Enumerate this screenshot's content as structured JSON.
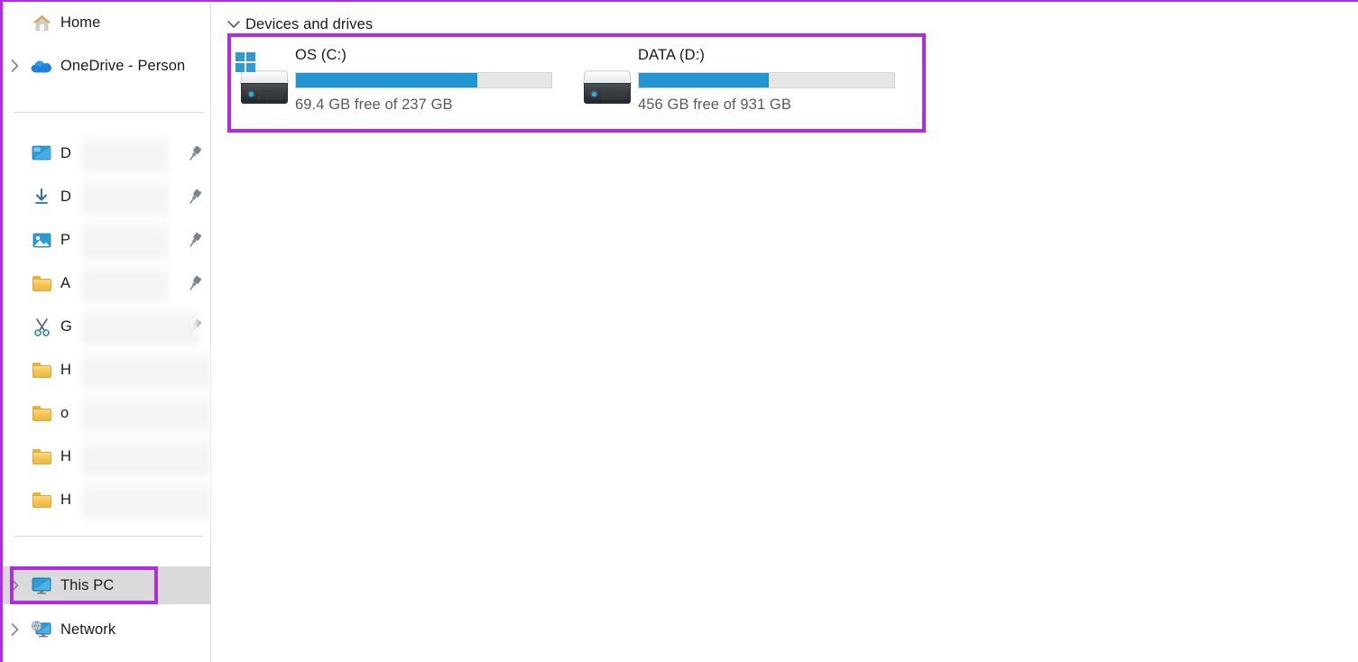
{
  "window": {
    "accent_purple": "#b02ae8",
    "selection_gray": "#dadada",
    "bar_blue": "#2196d3",
    "bar_track": "#e6e6e6"
  },
  "sidebar": {
    "items": [
      {
        "label": "Home",
        "icon": "home-icon",
        "chevron": false,
        "pinned": false,
        "blurred": false
      },
      {
        "label": "OneDrive - Person",
        "icon": "onedrive-cloud-icon",
        "chevron": true,
        "pinned": false,
        "blurred": false
      },
      {
        "label": "D",
        "icon": "desktop-icon",
        "chevron": false,
        "pinned": true,
        "blurred": true
      },
      {
        "label": "D",
        "icon": "downloads-icon",
        "chevron": false,
        "pinned": true,
        "blurred": true
      },
      {
        "label": "P",
        "icon": "pictures-icon",
        "chevron": false,
        "pinned": true,
        "blurred": true
      },
      {
        "label": "A",
        "icon": "folder-icon",
        "chevron": false,
        "pinned": true,
        "blurred": true
      },
      {
        "label": "G",
        "icon": "scissors-icon",
        "chevron": false,
        "pinned": true,
        "blurred": true
      },
      {
        "label": "H",
        "icon": "folder-icon",
        "chevron": false,
        "pinned": false,
        "blurred": true
      },
      {
        "label": "o",
        "icon": "folder-icon",
        "chevron": false,
        "pinned": false,
        "blurred": true
      },
      {
        "label": "H",
        "icon": "folder-icon",
        "chevron": false,
        "pinned": false,
        "blurred": true
      },
      {
        "label": "H",
        "icon": "folder-icon",
        "chevron": false,
        "pinned": false,
        "blurred": true
      },
      {
        "label": "This PC",
        "icon": "this-pc-icon",
        "chevron": true,
        "pinned": false,
        "blurred": false,
        "selected": true,
        "highlighted": true
      },
      {
        "label": "Network",
        "icon": "network-icon",
        "chevron": true,
        "pinned": false,
        "blurred": false
      }
    ]
  },
  "main": {
    "group": {
      "title": "Devices and drives",
      "expanded": true,
      "chevron_icon": "chevron-down-icon",
      "highlighted": true
    },
    "drives": [
      {
        "name": "OS (C:)",
        "free_text": "69.4 GB free of 237 GB",
        "free_value": "69.4 GB",
        "total_value": "237 GB",
        "used_percent": 71,
        "icon": "windows-drive-icon"
      },
      {
        "name": "DATA (D:)",
        "free_text": "456 GB free of 931 GB",
        "free_value": "456 GB",
        "total_value": "931 GB",
        "used_percent": 51,
        "icon": "hard-drive-icon"
      }
    ]
  }
}
